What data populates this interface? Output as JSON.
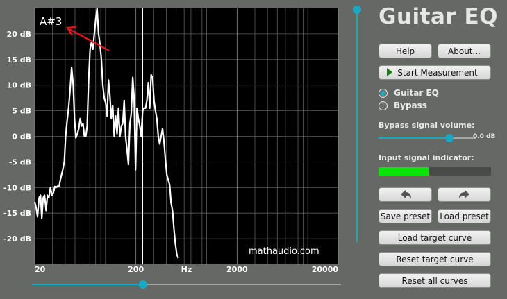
{
  "chart_data": {
    "type": "line",
    "xscale": "log",
    "xlim": [
      20,
      20000
    ],
    "ylim": [
      -25,
      25
    ],
    "x_ticks": [
      "20",
      "200",
      "Hz",
      "2000",
      "20000"
    ],
    "y_ticks": [
      "20 dB",
      "15 dB",
      "10 dB",
      "5 dB",
      "0 dB",
      "-5 dB",
      "-10 dB",
      "-15 dB",
      "-20 dB"
    ],
    "grid": true,
    "annotation": "A#3",
    "watermark": "mathaudio.com",
    "marker_frequency_hz": 233,
    "series": [
      {
        "color": "#ffffff",
        "points": [
          [
            20,
            -12.8
          ],
          [
            20.7,
            -14
          ],
          [
            21.3,
            -15.7
          ],
          [
            22.1,
            -12
          ],
          [
            22.8,
            -11.5
          ],
          [
            23.5,
            -16
          ],
          [
            24.2,
            -12
          ],
          [
            25,
            -11.5
          ],
          [
            25.9,
            -14.5
          ],
          [
            26.7,
            -11.5
          ],
          [
            27.6,
            -12
          ],
          [
            28.6,
            -10
          ],
          [
            29.6,
            -11.5
          ],
          [
            30.6,
            -11
          ],
          [
            31.6,
            -9.8
          ],
          [
            32.6,
            -10
          ],
          [
            33.7,
            -9.7
          ],
          [
            34.8,
            -9.8
          ],
          [
            36.3,
            -8
          ],
          [
            37.9,
            -6.5
          ],
          [
            39.2,
            -5
          ],
          [
            40.4,
            0
          ],
          [
            41.8,
            3
          ],
          [
            43.2,
            5.5
          ],
          [
            44.5,
            8.5
          ],
          [
            46.3,
            13.5
          ],
          [
            48,
            10
          ],
          [
            49.5,
            3.5
          ],
          [
            51,
            -0.3
          ],
          [
            52.7,
            0.5
          ],
          [
            54.5,
            1.5
          ],
          [
            56.3,
            3.5
          ],
          [
            58.1,
            2
          ],
          [
            60,
            2.5
          ],
          [
            61.9,
            0
          ],
          [
            63.9,
            0
          ],
          [
            66,
            2
          ],
          [
            68.2,
            11
          ],
          [
            70.5,
            17
          ],
          [
            72.8,
            18.3
          ],
          [
            75.1,
            17
          ],
          [
            77.6,
            20
          ],
          [
            80.2,
            23
          ],
          [
            82.7,
            25
          ],
          [
            85.5,
            20
          ],
          [
            88.3,
            18
          ],
          [
            91.2,
            15
          ],
          [
            94.2,
            10
          ],
          [
            97.3,
            7.5
          ],
          [
            100.5,
            6.5
          ],
          [
            103.8,
            4
          ],
          [
            107.2,
            11
          ],
          [
            110.7,
            8
          ],
          [
            114.3,
            3.5
          ],
          [
            118.1,
            6
          ],
          [
            122,
            0
          ],
          [
            126,
            4
          ],
          [
            130.2,
            0.5
          ],
          [
            134.5,
            5.5
          ],
          [
            138.9,
            0
          ],
          [
            143.5,
            2
          ],
          [
            148.2,
            2.5
          ],
          [
            153.1,
            7
          ],
          [
            158.1,
            0
          ],
          [
            163.3,
            -2.5
          ],
          [
            168.7,
            -5.5
          ],
          [
            174.3,
            2.5
          ],
          [
            180,
            4.5
          ],
          [
            186,
            11.5
          ],
          [
            192,
            7.5
          ],
          [
            198.4,
            -6.5
          ],
          [
            204.8,
            5.5
          ],
          [
            211.6,
            3.5
          ],
          [
            218.5,
            2
          ],
          [
            225.7,
            0
          ],
          [
            233.2,
            5
          ],
          [
            240.8,
            5.5
          ],
          [
            248.8,
            5.5
          ],
          [
            256.9,
            7
          ],
          [
            265.4,
            10.5
          ],
          [
            274.1,
            5.5
          ],
          [
            283.1,
            12
          ],
          [
            292.4,
            11.5
          ],
          [
            302,
            7
          ],
          [
            312,
            5
          ],
          [
            322.2,
            3.5
          ],
          [
            332.8,
            0
          ],
          [
            343.8,
            -1.5
          ],
          [
            355.1,
            0
          ],
          [
            366.8,
            1.5
          ],
          [
            378.8,
            -1
          ],
          [
            391.3,
            -4.5
          ],
          [
            404.2,
            -7.5
          ],
          [
            417.5,
            -8.5
          ],
          [
            431.2,
            -9.5
          ],
          [
            445.4,
            -13
          ],
          [
            460,
            -14.5
          ],
          [
            475.2,
            -18
          ],
          [
            490.8,
            -21
          ],
          [
            507,
            -23
          ],
          [
            523.7,
            -23.8
          ]
        ]
      }
    ]
  },
  "header": {
    "title": "Guitar EQ"
  },
  "buttons": {
    "help": "Help",
    "about": "About...",
    "start_measurement": "Start Measurement",
    "save_preset": "Save preset",
    "load_preset": "Load preset",
    "load_target": "Load target curve",
    "reset_target": "Reset target curve",
    "reset_all": "Reset all curves"
  },
  "mode": {
    "options": [
      "Guitar EQ",
      "Bypass"
    ],
    "selected": "Guitar EQ"
  },
  "bypass_volume": {
    "label": "Bypass signal volume:",
    "value": "0.0 dB",
    "level": 0.73
  },
  "input_signal": {
    "label": "Input signal indicator:",
    "level": 0.45
  },
  "vertical_slider": {
    "level": 1.0
  },
  "frequency_slider": {
    "level": 0.36
  },
  "colors": {
    "accent": "#19a9c2",
    "meter": "#0ae20a",
    "annotation_arrow": "#e8161b",
    "plot_background": "#000000",
    "panel_background": "#656865"
  },
  "icons": {
    "undo": "undo-arrow-icon",
    "redo": "redo-arrow-icon",
    "play": "play-icon"
  }
}
